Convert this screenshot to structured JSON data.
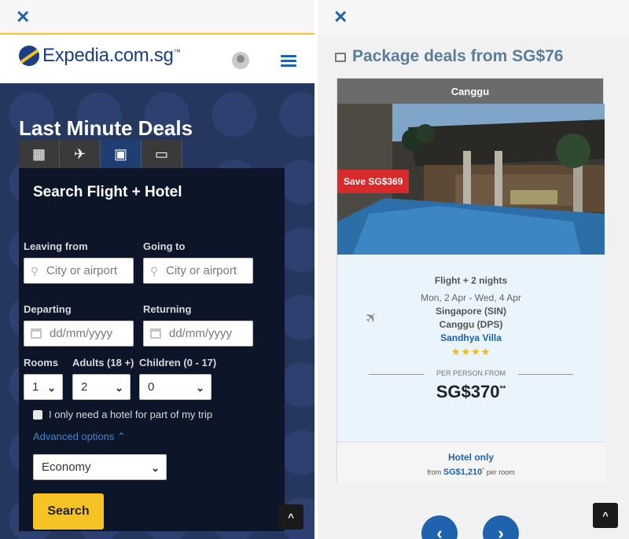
{
  "left": {
    "logo_text": "Expedia.com.sg",
    "logo_tm": "™",
    "hero_title": "Last Minute Deals",
    "tabs": [
      {
        "name": "hotel",
        "glyph": "▦"
      },
      {
        "name": "flight",
        "glyph": "✈"
      },
      {
        "name": "flight-hotel",
        "glyph": "▣"
      },
      {
        "name": "activities",
        "glyph": "▭"
      }
    ],
    "form": {
      "title": "Search Flight + Hotel",
      "leaving_label": "Leaving from",
      "leaving_placeholder": "City or airport",
      "going_label": "Going to",
      "going_placeholder": "City or airport",
      "departing_label": "Departing",
      "departing_placeholder": "dd/mm/yyyy",
      "returning_label": "Returning",
      "returning_placeholder": "dd/mm/yyyy",
      "rooms_label": "Rooms",
      "rooms_value": "1",
      "adults_label": "Adults (18 +)",
      "adults_value": "2",
      "children_label": "Children (0 - 17)",
      "children_value": "0",
      "hotel_part_label": "I only need a hotel for part of my trip",
      "advanced_label": "Advanced options ⌃",
      "cabin_value": "Economy",
      "search_label": "Search"
    }
  },
  "right": {
    "title": "Package deals from SG$76",
    "card": {
      "destination": "Canggu",
      "save_badge": "Save SG$369",
      "package_type": "Flight + 2 nights",
      "dates": "Mon, 2 Apr - Wed, 4 Apr",
      "origin": "Singapore (SIN)",
      "dest_airport": "Canggu (DPS)",
      "hotel_name": "Sandhya Villa",
      "stars_rating": 4,
      "stars_text": "★★★★",
      "per_person_label": "PER PERSON FROM",
      "price": "SG$370",
      "price_sup": "**",
      "hotel_only_label": "Hotel only",
      "hotel_from_prefix": "from",
      "hotel_from_price": "SG$1,210",
      "hotel_from_sup": "*",
      "hotel_from_suffix": "per room"
    }
  },
  "icons": {
    "close": "✕",
    "up": "^",
    "prev": "‹",
    "next": "›",
    "plane": "✈",
    "pin": "⚲",
    "chevron": "⌄"
  },
  "colors": {
    "brand_blue": "#1f62ad",
    "brand_navy": "#1a3f84",
    "accent_yellow": "#f6c325",
    "save_red": "#d72a2a"
  }
}
